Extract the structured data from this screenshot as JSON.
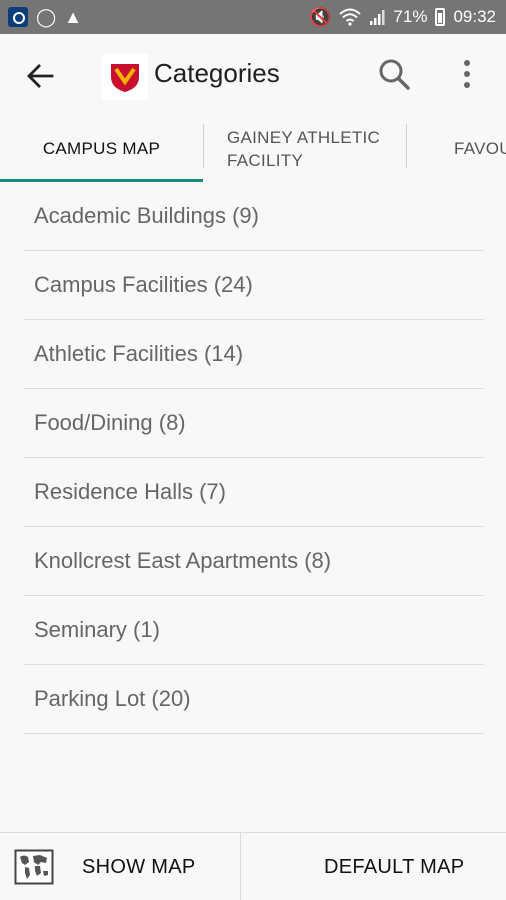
{
  "status_bar": {
    "battery": "71%",
    "time": "09:32"
  },
  "app_bar": {
    "title": "Categories"
  },
  "tabs": [
    {
      "label": "CAMPUS MAP",
      "selected": true
    },
    {
      "label": "GAINEY ATHLETIC FACILITY",
      "selected": false
    },
    {
      "label": "FAVOU",
      "selected": false
    }
  ],
  "categories": [
    {
      "label": "Academic Buildings (9)"
    },
    {
      "label": "Campus Facilities (24)"
    },
    {
      "label": "Athletic Facilities (14)"
    },
    {
      "label": "Food/Dining (8)"
    },
    {
      "label": "Residence Halls (7)"
    },
    {
      "label": "Knollcrest East Apartments (8)"
    },
    {
      "label": "Seminary (1)"
    },
    {
      "label": "Parking Lot (20)"
    }
  ],
  "bottom_bar": {
    "show_map_label": "SHOW MAP",
    "default_map_label": "DEFAULT MAP"
  },
  "colors": {
    "status_bar": "#757575",
    "tab_indicator": "#1a8a7a",
    "logo_red": "#c8102e",
    "logo_gold": "#f2b300"
  }
}
